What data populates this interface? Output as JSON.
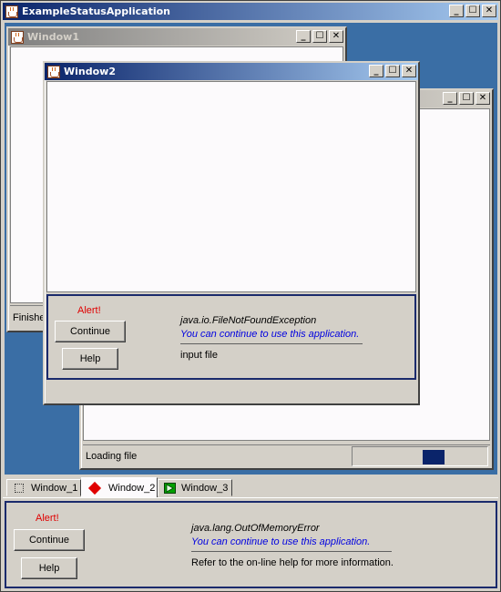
{
  "app": {
    "title": "ExampleStatusApplication"
  },
  "window_buttons": {
    "minimize": "_",
    "maximize": "☐",
    "close": "✕"
  },
  "window1": {
    "title": "Window1",
    "status": "Finishe"
  },
  "window2": {
    "title": "Window2",
    "alert": {
      "label": "Alert!",
      "continue_label": "Continue",
      "help_label": "Help",
      "exception": "java.io.FileNotFoundException",
      "message": "You can continue to use this application.",
      "detail": "input file"
    }
  },
  "window3": {
    "status": "Loading file",
    "progress": 0.62
  },
  "tabs": [
    {
      "label": "Window_1",
      "icon": "window-icon"
    },
    {
      "label": "Window_2",
      "icon": "red-diamond-icon"
    },
    {
      "label": "Window_3",
      "icon": "green-arrow-icon"
    }
  ],
  "bottom_alert": {
    "label": "Alert!",
    "continue_label": "Continue",
    "help_label": "Help",
    "exception": "java.lang.OutOfMemoryError",
    "message": "You can continue to use this application.",
    "detail": "Refer to the on-line help for more information."
  },
  "colors": {
    "titlebar_active_start": "#0a246a",
    "titlebar_active_end": "#a6caf0",
    "titlebar_inactive_start": "#808080",
    "titlebar_inactive_end": "#d4d0c8",
    "desktop": "#3a6ea5",
    "alert_red": "#e00000",
    "message_blue": "#0000e0",
    "panel_border": "#1a2a6c",
    "progress_fill": "#0a246a"
  }
}
